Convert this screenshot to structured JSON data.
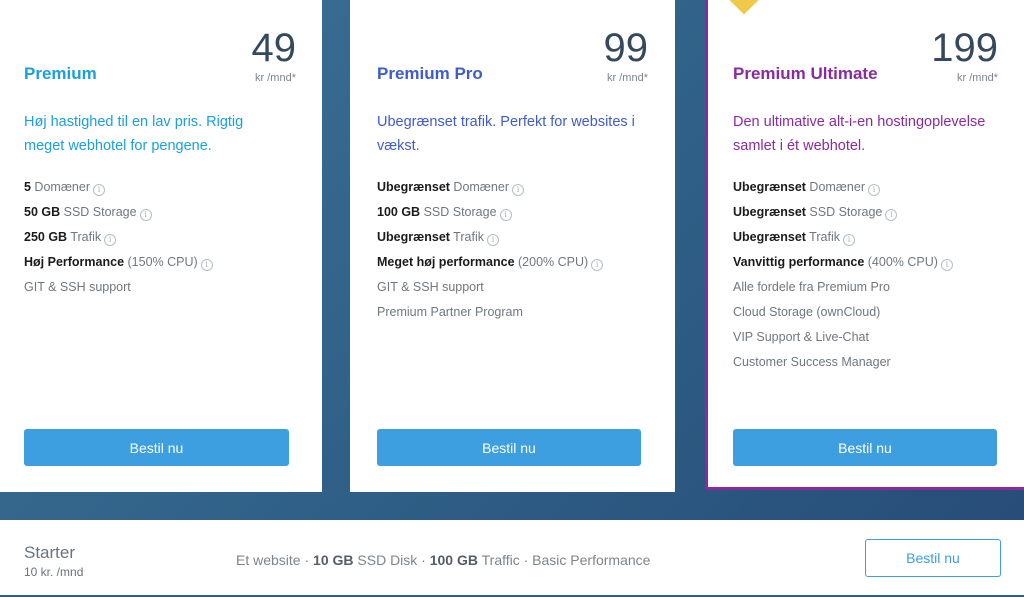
{
  "plans": [
    {
      "name": "Premium",
      "price": "49",
      "unit": "kr /mnd*",
      "description": "Høj hastighed til en lav pris. Rigtig meget webhotel for pengene.",
      "features": [
        {
          "bold": "5",
          "text": " Domæner",
          "info": true
        },
        {
          "bold": "50 GB",
          "text": " SSD Storage",
          "info": true
        },
        {
          "bold": "250 GB",
          "text": " Trafik",
          "info": true
        },
        {
          "bold": "Høj Performance",
          "text": " (150% CPU)",
          "info": true
        },
        {
          "bold": "",
          "text": "GIT & SSH support",
          "info": false
        }
      ],
      "button": "Bestil nu",
      "color": "#1a9fe0"
    },
    {
      "name": "Premium Pro",
      "price": "99",
      "unit": "kr /mnd*",
      "description": "Ubegrænset trafik. Perfekt for websites i vækst.",
      "features": [
        {
          "bold": "Ubegrænset",
          "text": " Domæner",
          "info": true
        },
        {
          "bold": "100 GB",
          "text": " SSD Storage",
          "info": true
        },
        {
          "bold": "Ubegrænset",
          "text": " Trafik",
          "info": true
        },
        {
          "bold": "Meget høj performance",
          "text": " (200% CPU)",
          "info": true
        },
        {
          "bold": "",
          "text": "GIT & SSH support",
          "info": false
        },
        {
          "bold": "",
          "text": "Premium Partner Program",
          "info": false
        }
      ],
      "button": "Bestil nu",
      "color": "#3e5ccc"
    },
    {
      "name": "Premium Ultimate",
      "price": "199",
      "unit": "kr /mnd*",
      "description": "Den ultimative alt-i-en hostingoplevelse samlet i ét webhotel.",
      "features": [
        {
          "bold": "Ubegrænset",
          "text": " Domæner",
          "info": true
        },
        {
          "bold": "Ubegrænset",
          "text": " SSD Storage",
          "info": true
        },
        {
          "bold": "Ubegrænset",
          "text": " Trafik",
          "info": true
        },
        {
          "bold": "Vanvittig performance",
          "text": " (400% CPU)",
          "info": true
        },
        {
          "bold": "",
          "text": "Alle fordele fra Premium Pro",
          "info": false
        },
        {
          "bold": "",
          "text": "Cloud Storage (ownCloud)",
          "info": false
        },
        {
          "bold": "",
          "text": "VIP Support & Live-Chat",
          "info": false
        },
        {
          "bold": "",
          "text": "Customer Success Manager",
          "info": false
        }
      ],
      "button": "Bestil nu",
      "color": "#8a2aa0"
    }
  ],
  "info_icon": "i",
  "starter": {
    "name": "Starter",
    "price": "10 kr. /mnd",
    "desc_parts": [
      {
        "bold": false,
        "text": "Et website · "
      },
      {
        "bold": true,
        "text": "10 GB"
      },
      {
        "bold": false,
        "text": " SSD Disk · "
      },
      {
        "bold": true,
        "text": "100 GB"
      },
      {
        "bold": false,
        "text": " Traffic · Basic Performance"
      }
    ],
    "button": "Bestil nu"
  }
}
